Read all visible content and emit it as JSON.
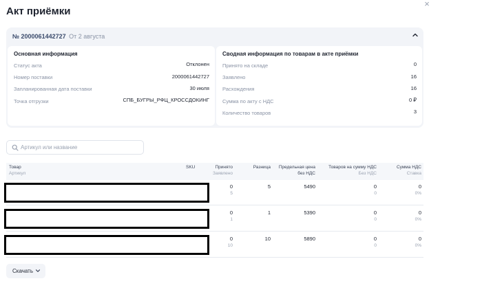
{
  "modal": {
    "title": "Акт приёмки",
    "close_glyph": "×"
  },
  "act": {
    "number": "№ 2000061442727",
    "date": "От 2 августа"
  },
  "main_info": {
    "title": "Основная информация",
    "rows": [
      {
        "label": "Статус акта",
        "value": "Отклонен"
      },
      {
        "label": "Номер поставки",
        "value": "2000061442727"
      },
      {
        "label": "Запланированная дата поставки",
        "value": "30 июля"
      },
      {
        "label": "Точка отгрузки",
        "value": "СПБ_БУГРЫ_РФЦ_КРОССДОКИНГ"
      }
    ]
  },
  "summary_info": {
    "title": "Сводная информация по товарам в акте приёмки",
    "rows": [
      {
        "label": "Принято на складе",
        "value": "0"
      },
      {
        "label": "Заявлено",
        "value": "16"
      },
      {
        "label": "Расхождения",
        "value": "16"
      },
      {
        "label": "Сумма по акту с НДС",
        "value": "0 ₽"
      },
      {
        "label": "Количество товаров",
        "value": "3"
      }
    ]
  },
  "search": {
    "placeholder": "Артикул или название"
  },
  "table": {
    "headers": {
      "product": "Товар",
      "article": "Артикул",
      "sku": "SKU",
      "accepted": "Принято",
      "declared": "Заявлено",
      "difference": "Разница",
      "price_line1": "Предельная цена",
      "price_line2": "без НДС",
      "goods_sum": "Товаров на сумму НДС",
      "goods_sum_sub": "Без НДС",
      "vat_sum": "Сумма НДС",
      "vat_rate": "Ставка"
    },
    "rows": [
      {
        "accepted": "0",
        "declared": "5",
        "difference": "5",
        "price": "5490",
        "goods_sum": "0",
        "goods_sub": "0",
        "vat_sum": "0",
        "vat_rate": "0%"
      },
      {
        "accepted": "0",
        "declared": "1",
        "difference": "1",
        "price": "5390",
        "goods_sum": "0",
        "goods_sub": "0",
        "vat_sum": "0",
        "vat_rate": "0%"
      },
      {
        "accepted": "0",
        "declared": "10",
        "difference": "10",
        "price": "5890",
        "goods_sum": "0",
        "goods_sub": "0",
        "vat_sum": "0",
        "vat_rate": "0%"
      }
    ]
  },
  "download": {
    "label": "Скачать"
  },
  "icons": {
    "close": "close-icon",
    "collapse": "chevron-up-icon",
    "search": "search-icon",
    "download_chevron": "chevron-down-icon"
  },
  "colors": {
    "card_bg": "#f2f4f8",
    "accent_text": "#3a4a6b",
    "muted_text": "#8a93a5"
  }
}
